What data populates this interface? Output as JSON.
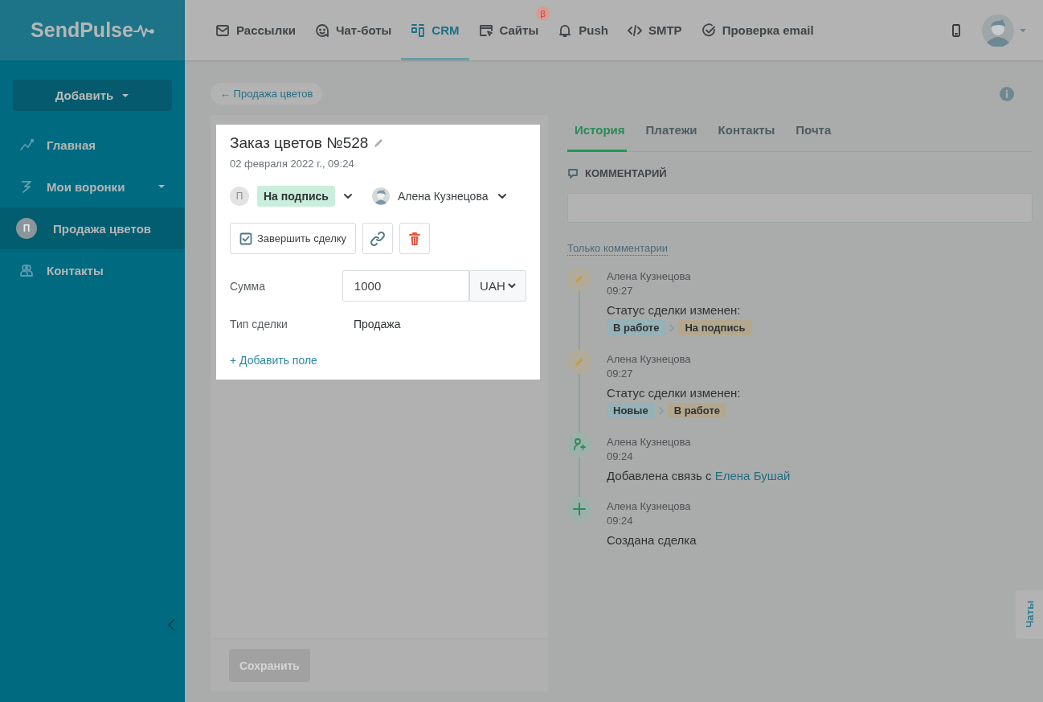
{
  "logo": {
    "text": "SendPulse"
  },
  "nav": [
    {
      "label": "Рассылки",
      "kind": "mail",
      "selected": false
    },
    {
      "label": "Чат-боты",
      "kind": "bot",
      "selected": false
    },
    {
      "label": "CRM",
      "kind": "crm",
      "selected": true
    },
    {
      "label": "Сайты",
      "kind": "site",
      "selected": false,
      "badge": "β"
    },
    {
      "label": "Push",
      "kind": "bell",
      "selected": false
    },
    {
      "label": "SMTP",
      "kind": "code",
      "selected": false
    },
    {
      "label": "Проверка email",
      "kind": "check",
      "selected": false
    }
  ],
  "sidebar": {
    "add_button": "Добавить",
    "items": [
      {
        "label": "Главная",
        "kind": "chart",
        "selected": false
      },
      {
        "label": "Мои воронки",
        "kind": "funnel",
        "selected": false,
        "expandable": true
      },
      {
        "label": "Продажа цветов",
        "kind": "pipeline",
        "avatar": "П",
        "selected": true
      },
      {
        "label": "Контакты",
        "kind": "contacts",
        "selected": false
      }
    ]
  },
  "breadcrumb": "← Продажа цветов",
  "deal": {
    "title": "Заказ цветов №528",
    "date": "02 февраля 2022 г., 09:24",
    "pipeline_avatar": "П",
    "status": "На подпись",
    "owner": "Алена Кузнецова",
    "complete_button": "Завершить сделку",
    "fields": [
      {
        "label": "Сумма",
        "kind": "money",
        "value": "1000",
        "currency": "UAH"
      },
      {
        "label": "Тип сделки",
        "kind": "text",
        "value": "Продажа"
      }
    ],
    "add_field": "+ Добавить поле",
    "save_button": {
      "label": "Сохранить",
      "disabled": true
    }
  },
  "tabs": [
    {
      "label": "История",
      "selected": true
    },
    {
      "label": "Платежи",
      "selected": false
    },
    {
      "label": "Контакты",
      "selected": false
    },
    {
      "label": "Почта",
      "selected": false
    }
  ],
  "comment": {
    "heading": "КОММЕНТАРИЙ"
  },
  "filter_link": "Только комментарии",
  "history": [
    {
      "kind": "status",
      "author": "Алена Кузнецова",
      "time": "09:27",
      "text": "Статус сделки изменен:",
      "from": "В работе",
      "to": "На подпись"
    },
    {
      "kind": "status",
      "author": "Алена Кузнецова",
      "time": "09:27",
      "text": "Статус сделки изменен:",
      "from": "Новые",
      "to": "В работе"
    },
    {
      "kind": "link",
      "author": "Алена Кузнецова",
      "time": "09:24",
      "text": "Добавлена связь с",
      "link": "Елена Бушай"
    },
    {
      "kind": "created",
      "author": "Алена Кузнецова",
      "time": "09:24",
      "text": "Создана сделка"
    }
  ],
  "chats_tab": "Чаты"
}
